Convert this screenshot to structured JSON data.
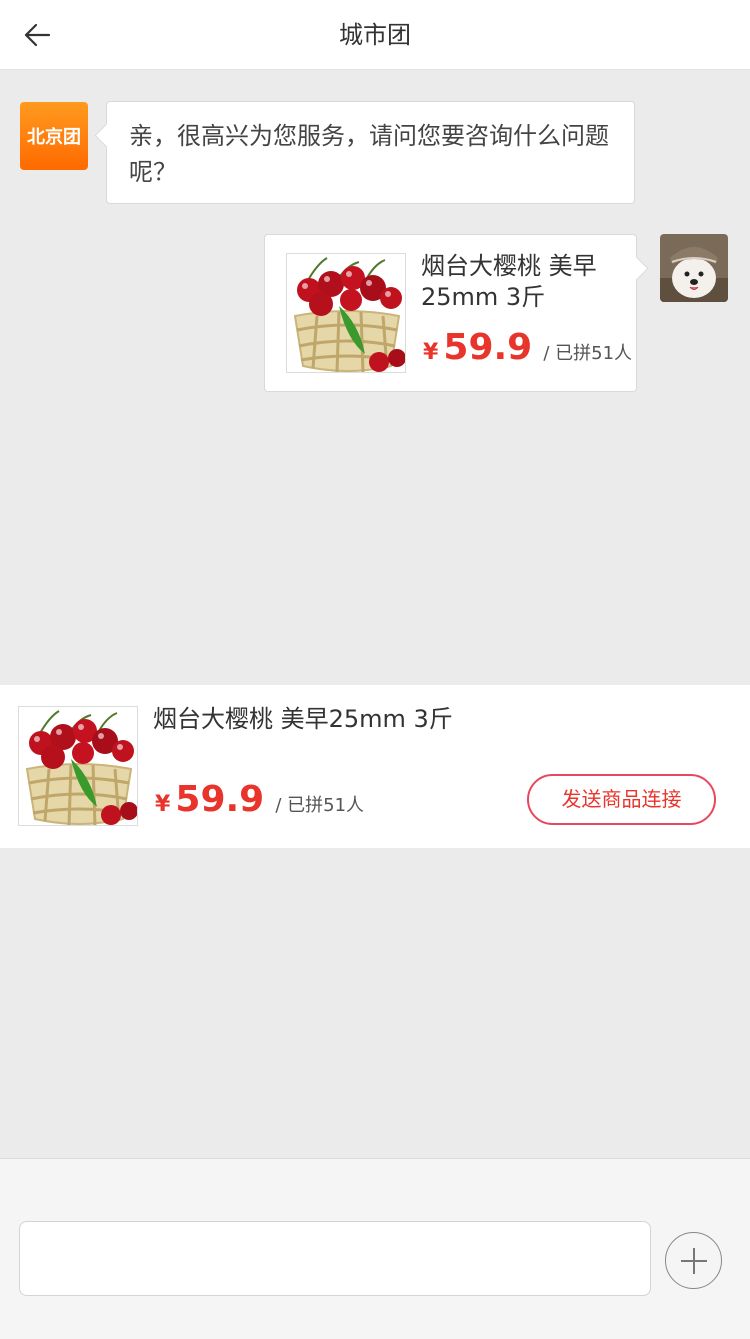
{
  "header": {
    "title": "城市团",
    "back_icon": "arrow-left-icon"
  },
  "chat": {
    "shop_avatar_label": "北京团",
    "greeting": "亲，很高兴为您服务，请问您要咨询什么问题呢？",
    "sent_product": {
      "name": "烟台大樱桃 美早25mm 3斤",
      "currency": "¥",
      "price": "59.9",
      "joined": "/ 已拼51人",
      "image_icon": "cherry-basket-image"
    },
    "user_avatar_icon": "dog-avatar-image"
  },
  "product_card": {
    "name": "烟台大樱桃 美早25mm 3斤",
    "currency": "¥",
    "price": "59.9",
    "joined": "/ 已拼51人",
    "send_button_label": "发送商品连接",
    "image_icon": "cherry-basket-image"
  },
  "input_bar": {
    "placeholder": "",
    "plus_icon": "plus-circle-icon"
  },
  "colors": {
    "accent_red": "#e8342b",
    "shop_orange": "#ff7a0a",
    "background": "#ebebeb"
  }
}
